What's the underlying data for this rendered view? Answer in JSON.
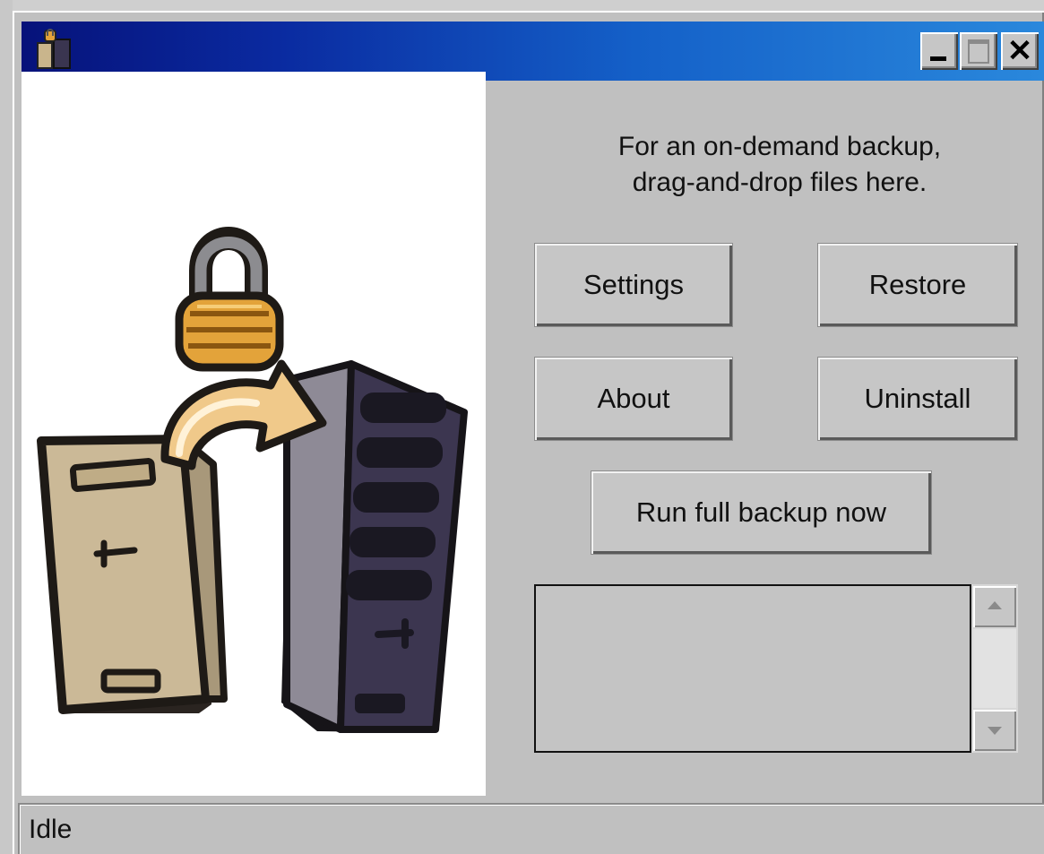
{
  "window": {
    "controls": {
      "minimize_icon": "minimize-icon",
      "maximize_icon": "maximize-icon",
      "close_glyph": "✕"
    },
    "title_gradient": [
      "#06127a",
      "#2a88dc"
    ]
  },
  "main": {
    "instruction_line1": "For an on-demand backup,",
    "instruction_line2": "drag-and-drop files here.",
    "buttons": {
      "settings": "Settings",
      "restore": "Restore",
      "about": "About",
      "uninstall": "Uninstall",
      "run_full_backup": "Run full backup now"
    },
    "log": {
      "text": ""
    }
  },
  "status": {
    "text": "Idle"
  },
  "illustration": {
    "icons": [
      "padlock-icon",
      "arrow-icon",
      "file-cabinet-icon",
      "server-tower-icon"
    ]
  }
}
